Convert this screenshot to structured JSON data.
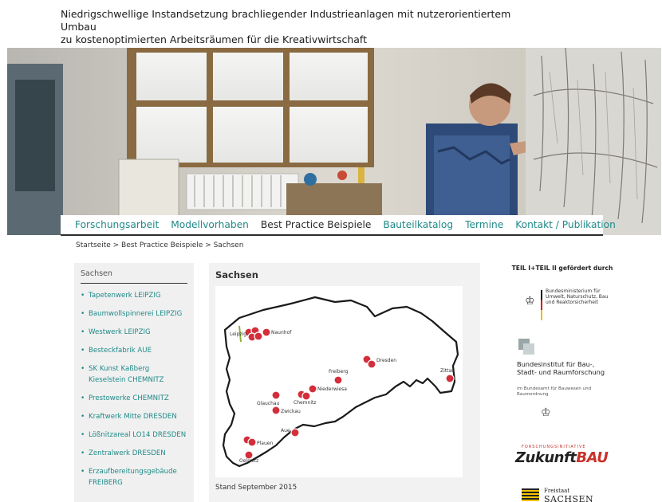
{
  "header": {
    "title_line1": "Niedrigschwellige Instandsetzung brachliegender Industrieanlagen mit nutzerorientiertem Umbau",
    "title_line2": "zu kostenoptimierten Arbeitsräumen für die Kreativwirtschaft"
  },
  "nav": {
    "items": [
      "Forschungsarbeit",
      "Modellvorhaben",
      "Best Practice Beispiele",
      "Bauteilkatalog",
      "Termine",
      "Kontakt / Publikation"
    ],
    "active_index": 2
  },
  "breadcrumb": "Startseite > Best Practice Beispiele > Sachsen",
  "sidebar": {
    "title": "Sachsen",
    "items": [
      "Tapetenwerk LEIPZIG",
      "Baumwollspinnerei LEIPZIG",
      "Westwerk LEIPZIG",
      "Besteckfabrik AUE",
      "SK Kunst Kaßberg Kieselstein CHEMNITZ",
      "Prestowerke CHEMNITZ",
      "Kraftwerk Mitte DRESDEN",
      "Lößnitzareal LO14 DRESDEN",
      "Zentralwerk DRESDEN",
      "Erzaufbereitungsgebäude FREIBERG"
    ]
  },
  "main": {
    "title": "Sachsen",
    "stand": "Stand September 2015",
    "map_labels": [
      "Leipzig",
      "Naunhof",
      "Dresden",
      "Freiberg",
      "Zittau",
      "Niederwiesa",
      "Glauchau",
      "Chemnitz",
      "Zwickau",
      "Aue",
      "Plauen",
      "Oelsnitz"
    ]
  },
  "sponsors": {
    "heading": "TEIL I+TEIL II gefördert durch",
    "bmub_text": "Bundesministerium für Umwelt, Naturschutz, Bau und Reaktorsicherheit",
    "bbsr_title": "Bundesinstitut für Bau-, Stadt- und Raumforschung",
    "bbsr_sub": "im Bundesamt für Bauwesen und Raumordnung",
    "zukunft_small": "FORSCHUNGSINITIATIVE",
    "zukunft_a": "Zukunft",
    "zukunft_b": "BAU",
    "sachsen_free": "Freistaat",
    "sachsen_name": "SACHSEN"
  },
  "colors": {
    "link": "#1f8a88",
    "marker": "#d42e3a",
    "panel_bg": "#f0f0f0"
  }
}
